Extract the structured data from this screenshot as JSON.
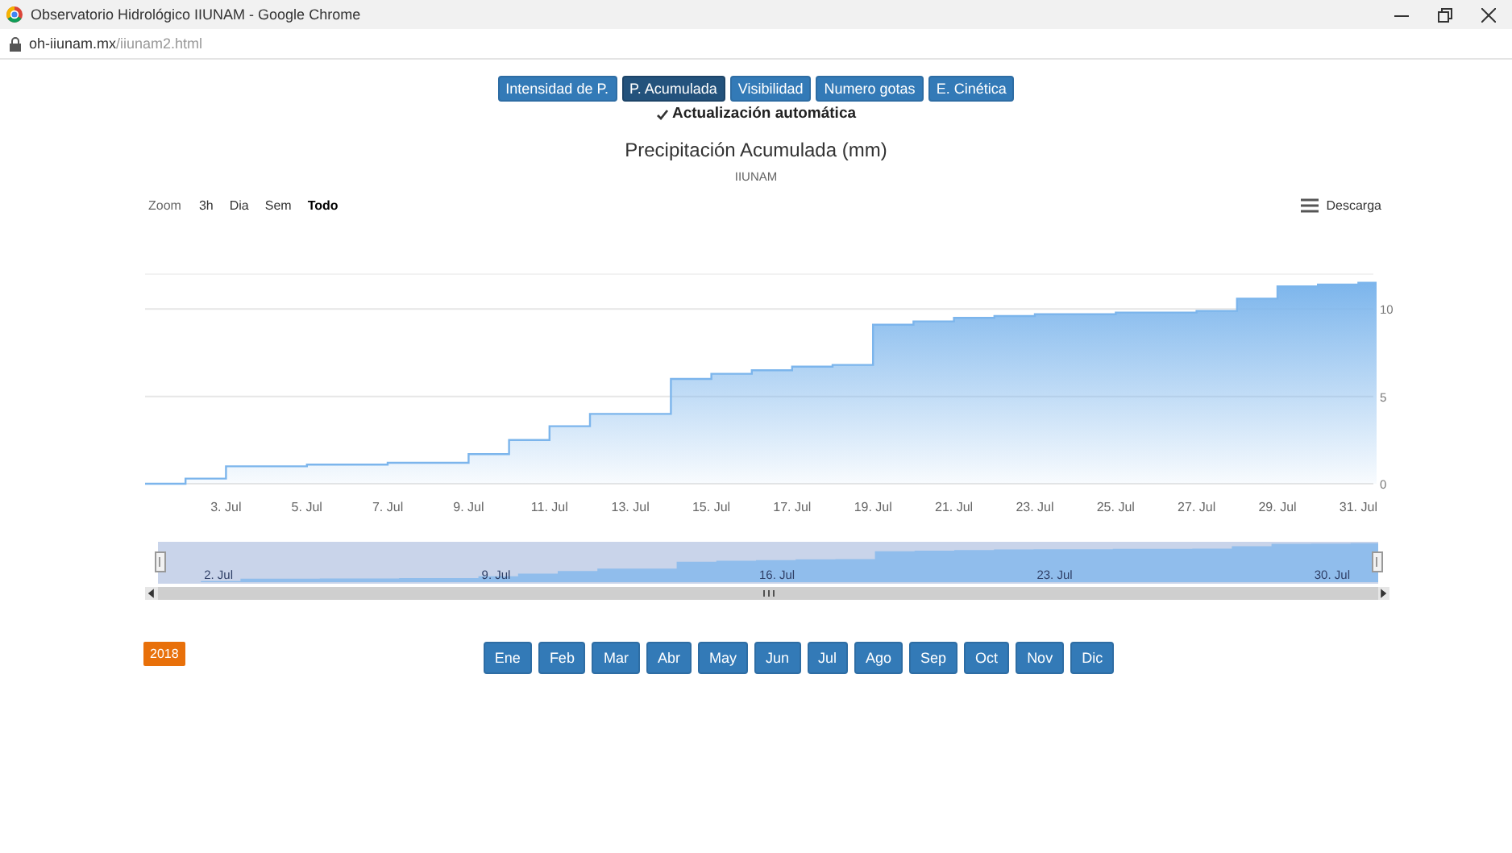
{
  "window": {
    "title": "Observatorio Hidrológico IIUNAM - Google Chrome",
    "url_host": "oh-iiunam.mx",
    "url_path": "/iiunam2.html"
  },
  "data_buttons": [
    {
      "label": "Intensidad de P.",
      "selected": false
    },
    {
      "label": "P. Acumulada",
      "selected": true
    },
    {
      "label": "Visibilidad",
      "selected": false
    },
    {
      "label": "Numero gotas",
      "selected": false
    },
    {
      "label": "E. Cinética",
      "selected": false
    }
  ],
  "auto_update": {
    "label": "Actualización automática",
    "checked": true
  },
  "chart": {
    "subtitle": "IIUNAM",
    "zoom_label": "Zoom",
    "zoom_buttons": [
      {
        "label": "3h",
        "selected": false
      },
      {
        "label": "Dia",
        "selected": false
      },
      {
        "label": "Sem",
        "selected": false
      },
      {
        "label": "Todo",
        "selected": true
      }
    ],
    "menu_label": "Descarga",
    "chart_data": {
      "type": "area",
      "title": "Precipitación Acumulada (mm)",
      "categories": [
        null,
        null,
        "3. Jul",
        null,
        "5. Jul",
        null,
        "7. Jul",
        null,
        "9. Jul",
        null,
        "11. Jul",
        null,
        "13. Jul",
        null,
        "15. Jul",
        null,
        "17. Jul",
        null,
        "19. Jul",
        null,
        "21. Jul",
        null,
        "23. Jul",
        null,
        "25. Jul",
        null,
        "27. Jul",
        null,
        "29. Jul",
        null,
        "31. Jul"
      ],
      "series": [
        {
          "color": "#7cb5ec",
          "values": [
            0,
            0.3,
            1.0,
            1.0,
            1.1,
            1.1,
            1.2,
            1.2,
            1.7,
            2.5,
            3.3,
            4.0,
            4.0,
            6.0,
            6.3,
            6.5,
            6.7,
            6.8,
            9.1,
            9.3,
            9.5,
            9.6,
            9.7,
            9.7,
            9.8,
            9.8,
            9.9,
            10.6,
            11.3,
            11.4,
            11.5
          ]
        }
      ],
      "ylim": [
        0,
        12
      ],
      "yticks": [
        0,
        5,
        10
      ]
    },
    "navigator": {
      "labels": [
        "2. Jul",
        "9. Jul",
        "16. Jul",
        "23. Jul",
        "30. Jul"
      ]
    }
  },
  "year": "2018",
  "months": [
    "Ene",
    "Feb",
    "Mar",
    "Abr",
    "May",
    "Jun",
    "Jul",
    "Ago",
    "Sep",
    "Oct",
    "Nov",
    "Dic"
  ]
}
